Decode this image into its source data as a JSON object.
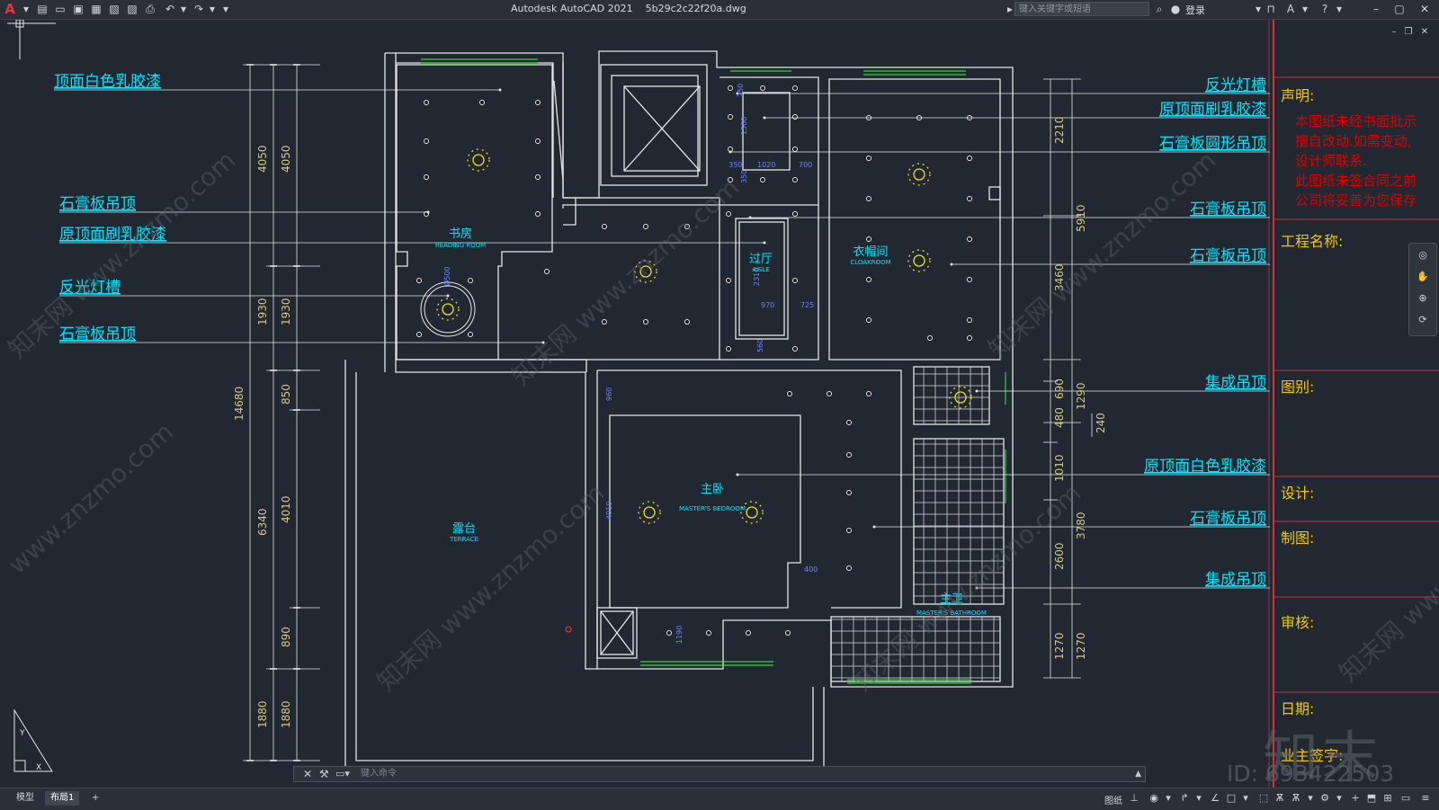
{
  "app": {
    "logo": "A",
    "title": "Autodesk AutoCAD 2021",
    "filename": "5b29c2c22f20a.dwg",
    "search_placeholder": "键入关键字或短语",
    "login": "登录"
  },
  "colors": {
    "annotation": "#00e5ff",
    "red_text": "#e00000",
    "yellow_label": "#f0c800",
    "dimension": "#d8c878",
    "walls": "#e6e6e6",
    "blue_dim": "#3a5cff",
    "green_window": "#35d435",
    "frame_red": "#ff3a3a"
  },
  "drawing": {
    "left_labels": [
      "顶面白色乳胶漆",
      "石膏板吊顶",
      "原顶面刷乳胶漆",
      "反光灯槽",
      "石膏板吊顶"
    ],
    "right_labels": [
      "反光灯槽",
      "原顶面刷乳胶漆",
      "石膏板圆形吊顶",
      "石膏板吊顶",
      "石膏板吊顶",
      "集成吊顶",
      "原顶面白色乳胶漆",
      "石膏板吊顶",
      "集成吊顶"
    ],
    "rooms": [
      {
        "cn": "书房",
        "en": "READING ROOM"
      },
      {
        "cn": "过厅",
        "en": "AISLE"
      },
      {
        "cn": "衣帽间",
        "en": "CLOAKROOM"
      },
      {
        "cn": "主卧",
        "en": "MASTER'S BEDROOM"
      },
      {
        "cn": "露台",
        "en": "TERRACE"
      },
      {
        "cn": "主卫",
        "en": "MASTER'S BATHROOM"
      }
    ],
    "dims_left_outer": [
      "14680"
    ],
    "dims_left_mid": [
      "4050",
      "1930",
      "6340",
      "1880"
    ],
    "dims_left_inner": [
      "4050",
      "1930",
      "850",
      "4010",
      "890",
      "1880"
    ],
    "dims_right_inner": [
      "2210",
      "3460",
      "690",
      "480",
      "1010",
      "2600",
      "1270"
    ],
    "dims_right_mid": [
      "5910",
      "1290",
      "3780",
      "1270"
    ],
    "dims_right_outer": [
      "240"
    ],
    "small_dims": [
      "250",
      "1560",
      "350",
      "1020",
      "700",
      "350",
      "2310",
      "970",
      "725",
      "560",
      "960",
      "4010",
      "400",
      "1190",
      "Ø500"
    ]
  },
  "title_block": {
    "statement_label": "声明:",
    "statement_lines": [
      "本图纸未经书面批示",
      "擅自改动.如需变动,",
      "设计师联系.",
      "此图纸未签合同之前",
      "公司将妥善为您保存"
    ],
    "project_label": "工程名称:",
    "type_label": "图别:",
    "design_label": "设计:",
    "draw_label": "制图:",
    "review_label": "审核:",
    "date_label": "日期:",
    "owner_label": "业主签字:"
  },
  "watermark": {
    "site": "www.znzmo.com",
    "brand_cn": "知末网",
    "brand_big": "知末",
    "id_text": "ID: 693422503"
  },
  "command": {
    "placeholder": "键入命令"
  },
  "statusbar": {
    "tabs": [
      "模型",
      "布局1"
    ],
    "add": "+",
    "paper": "图纸"
  }
}
